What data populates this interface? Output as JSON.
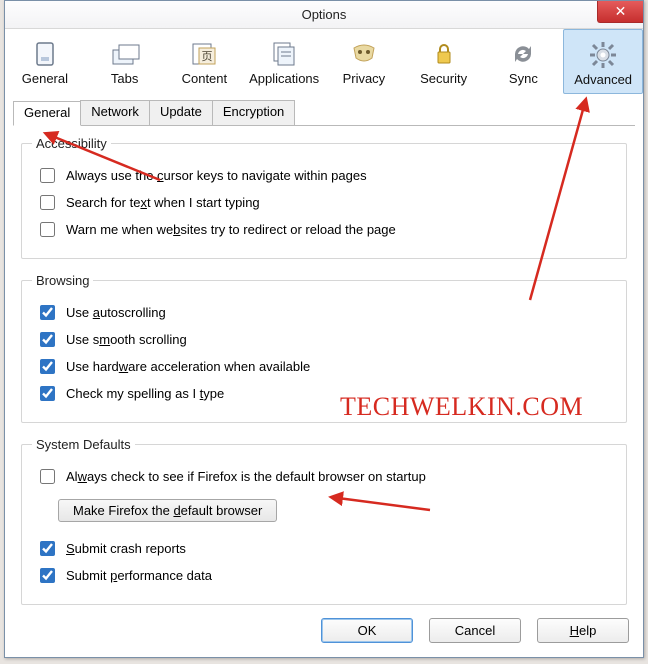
{
  "window": {
    "title": "Options"
  },
  "close_btn_label": "✕",
  "toolbar": [
    {
      "id": "general",
      "label": "General",
      "icon": "box-icon",
      "selected": false
    },
    {
      "id": "tabs",
      "label": "Tabs",
      "icon": "tabs-icon",
      "selected": false
    },
    {
      "id": "content",
      "label": "Content",
      "icon": "page-icon",
      "selected": false
    },
    {
      "id": "applications",
      "label": "Applications",
      "icon": "apps-icon",
      "selected": false
    },
    {
      "id": "privacy",
      "label": "Privacy",
      "icon": "mask-icon",
      "selected": false
    },
    {
      "id": "security",
      "label": "Security",
      "icon": "lock-icon",
      "selected": false
    },
    {
      "id": "sync",
      "label": "Sync",
      "icon": "sync-icon",
      "selected": false
    },
    {
      "id": "advanced",
      "label": "Advanced",
      "icon": "gear-icon",
      "selected": true
    }
  ],
  "subtabs": [
    {
      "label": "General",
      "active": true
    },
    {
      "label": "Network",
      "active": false
    },
    {
      "label": "Update",
      "active": false
    },
    {
      "label": "Encryption",
      "active": false
    }
  ],
  "groups": {
    "accessibility": {
      "legend": "Accessibility",
      "items": [
        {
          "checked": false,
          "pre": "Always use the ",
          "hot": "c",
          "post": "ursor keys to navigate within pages"
        },
        {
          "checked": false,
          "pre": "Search for te",
          "hot": "x",
          "post": "t when I start typing"
        },
        {
          "checked": false,
          "pre": "Warn me when we",
          "hot": "b",
          "post": "sites try to redirect or reload the page"
        }
      ]
    },
    "browsing": {
      "legend": "Browsing",
      "items": [
        {
          "checked": true,
          "pre": "Use ",
          "hot": "a",
          "post": "utoscrolling"
        },
        {
          "checked": true,
          "pre": "Use s",
          "hot": "m",
          "post": "ooth scrolling"
        },
        {
          "checked": true,
          "pre": "Use hard",
          "hot": "w",
          "post": "are acceleration when available"
        },
        {
          "checked": true,
          "pre": "Check my spelling as I ",
          "hot": "t",
          "post": "ype"
        }
      ]
    },
    "system": {
      "legend": "System Defaults",
      "default_check": {
        "checked": false,
        "pre": "Al",
        "hot": "w",
        "post": "ays check to see if Firefox is the default browser on startup"
      },
      "default_btn": {
        "pre": "Make Firefox the ",
        "hot": "d",
        "post": "efault browser"
      },
      "items": [
        {
          "checked": true,
          "pre": "",
          "hot": "S",
          "post": "ubmit crash reports"
        },
        {
          "checked": true,
          "pre": "Submit ",
          "hot": "p",
          "post": "erformance data"
        }
      ]
    }
  },
  "buttons": {
    "ok": "OK",
    "cancel": "Cancel",
    "help_pre": "",
    "help_hot": "H",
    "help_post": "elp"
  },
  "watermark": "TECHWELKIN.COM"
}
